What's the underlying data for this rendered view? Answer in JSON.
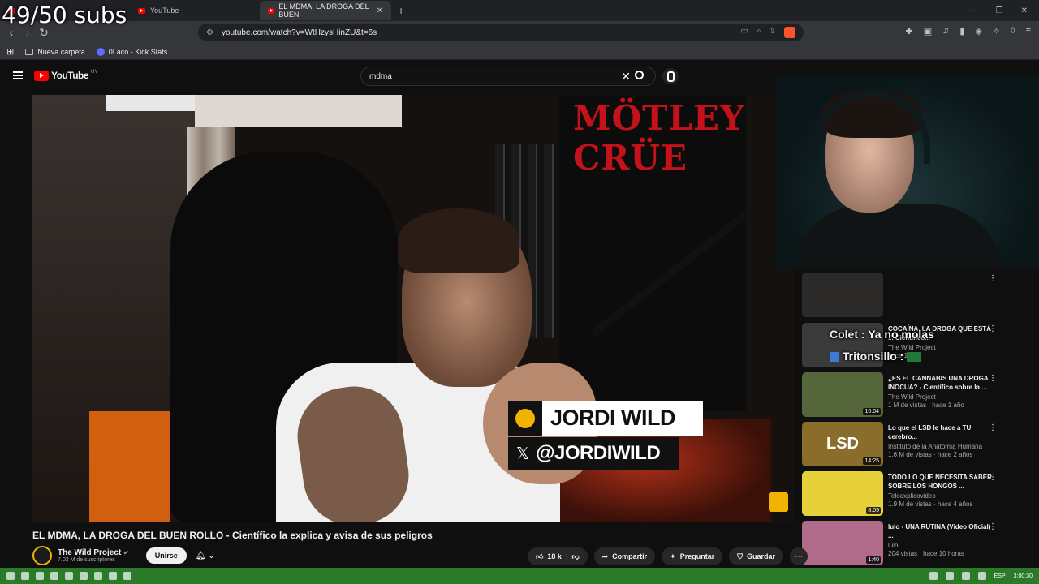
{
  "overlay": {
    "subs_counter": "49/50 subs"
  },
  "browser": {
    "tabs": [
      {
        "label": "YouTube"
      },
      {
        "label": "EL MDMA, LA DROGA DEL BUEN"
      }
    ],
    "url": "youtube.com/watch?v=WtHzysHinZU&t=6s",
    "bookmarks": [
      {
        "label": "Nueva carpeta",
        "icon": "folder-icon"
      },
      {
        "label": "0Laco - Kick Stats",
        "icon": "kick-icon"
      }
    ]
  },
  "youtube": {
    "logo_text": "YouTube",
    "country_code": "UY",
    "search_value": "mdma"
  },
  "video": {
    "badge_name": "JORDI WILD",
    "badge_handle": "@JORDIWILD",
    "poster_text": "MÖTLEY CRÜE",
    "title": "EL MDMA, LA DROGA DEL BUEN ROLLO - Científico la explica y avisa de sus peligros"
  },
  "channel": {
    "name": "The Wild Project",
    "subscribers": "7.02 M de suscriptores",
    "join_label": "Unirse"
  },
  "actions": {
    "likes": "18 k",
    "share": "Compartir",
    "ask": "Preguntar",
    "save": "Guardar"
  },
  "chat": {
    "line2_user": "Colet",
    "line2_text": ": Ya no molas",
    "line3_user": "Tritonsillo",
    "line3_text": ":"
  },
  "recommendations": [
    {
      "title": "COCAÍNA, LA DROGA QUE ESTÁ ... Científico...",
      "channel": "The Wild Project",
      "views": "hace 1 año",
      "duration": "",
      "color": "#3a3a3a",
      "big": ""
    },
    {
      "title": "¿ES EL CANNABIS UNA DROGA INOCUA? - Científico sobre la ...",
      "channel": "The Wild Project",
      "views": "1 M de vistas · hace 1 año",
      "duration": "10:04",
      "color": "#55663a",
      "big": ""
    },
    {
      "title": "Lo que el LSD le hace a TU cerebro...",
      "channel": "Instituto de la Anatomía Humana",
      "views": "1.6 M de vistas · hace 2 años",
      "duration": "14:25",
      "color": "#8a6d2a",
      "big": "LSD"
    },
    {
      "title": "TODO LO QUE NECESITA SABER SOBRE LOS HONGOS ...",
      "channel": "Teloexplicovideo",
      "views": "1.9 M de vistas · hace 4 años",
      "duration": "8:09",
      "color": "#e7d13a",
      "big": ""
    },
    {
      "title": "lulo - UNA RUTINA (Video Oficial) ...",
      "channel": "lulo",
      "views": "204 vistas · hace 10 horas",
      "duration": "1:40",
      "color": "#b06a8a",
      "big": ""
    }
  ],
  "taskbar": {
    "lang": "ESP",
    "time": "3:00:30"
  }
}
